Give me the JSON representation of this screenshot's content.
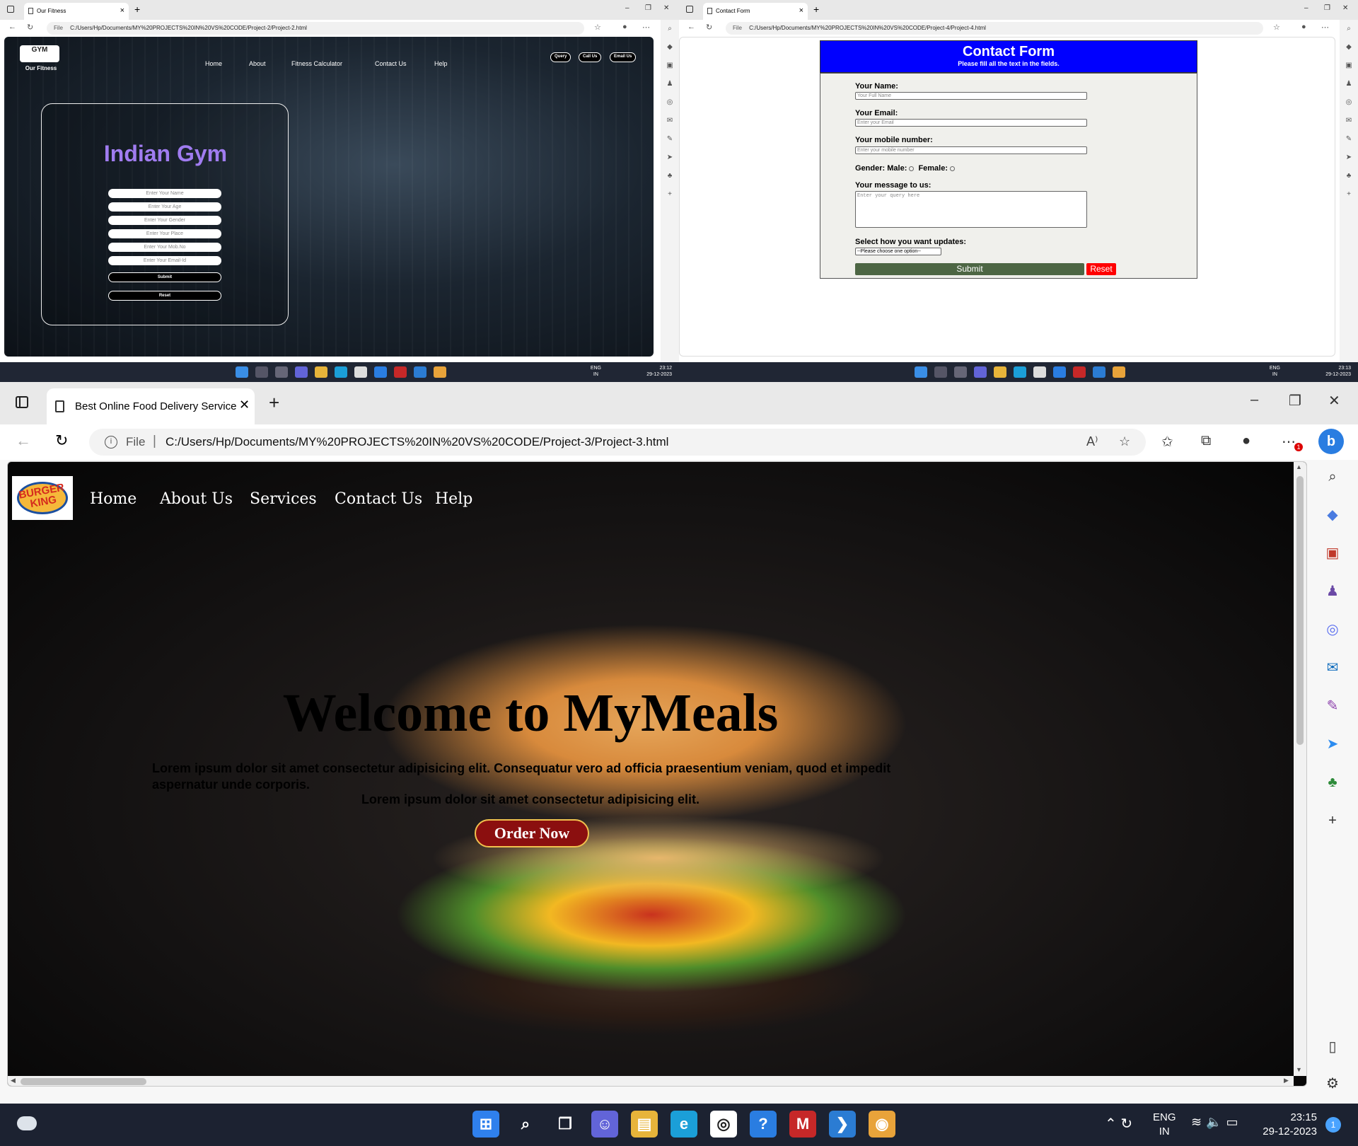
{
  "gym_window": {
    "tab_title": "Our Fitness",
    "url_file": "File",
    "url": "C:/Users/Hp/Documents/MY%20PROJECTS%20IN%20VS%20CODE/Project-2/Project-2.html",
    "logo_badge": "GYM",
    "logo_caption": "Our Fitness",
    "nav": [
      "Home",
      "About",
      "Fitness Calculator",
      "Contact Us",
      "Help"
    ],
    "pills": [
      "Query",
      "Call Us",
      "Email Us"
    ],
    "title": "Indian Gym",
    "placeholders": [
      "Enter Your Name",
      "Enter Your Age",
      "Enter Your Gender",
      "Enter Your Place",
      "Enter Your Mob.No",
      "Enter Your Email-Id"
    ],
    "submit": "Submit",
    "reset": "Reset",
    "taskbar": {
      "lang": "ENG",
      "region": "IN",
      "time": "23:12",
      "date": "29-12-2023"
    }
  },
  "contact_window": {
    "tab_title": "Contact Form",
    "url_file": "File",
    "url": "C:/Users/Hp/Documents/MY%20PROJECTS%20IN%20VS%20CODE/Project-4/Project-4.html",
    "header_title": "Contact Form",
    "header_subtitle": "Please fill all the text in the fields.",
    "name_label": "Your Name:",
    "name_placeholder": "Your Full Name",
    "email_label": "Your Email:",
    "email_placeholder": "Enter your Email",
    "mobile_label": "Your mobile number:",
    "mobile_placeholder": "Enter your mobile number",
    "gender_label": "Gender:",
    "male": "Male:",
    "female": "Female:",
    "message_label": "Your message to us:",
    "message_placeholder": "Enter your query here",
    "updates_label": "Select how you want updates:",
    "select_value": "--Please choose one option--",
    "submit": "Submit",
    "reset": "Reset",
    "taskbar": {
      "lang": "ENG",
      "region": "IN",
      "time": "23:13",
      "date": "29-12-2023"
    }
  },
  "main_window": {
    "tab_title": "Best Online Food Delivery Service",
    "url_file": "File",
    "url": "C:/Users/Hp/Documents/MY%20PROJECTS%20IN%20VS%20CODE/Project-3/Project-3.html",
    "notification_badge": "1",
    "logo_text_top": "BURGER",
    "logo_text_bottom": "KING",
    "nav": [
      "Home",
      "About Us",
      "Services",
      "Contact Us",
      "Help"
    ],
    "hero_title": "Welcome to MyMeals",
    "hero_paragraph": "Lorem ipsum dolor sit amet consectetur adipisicing elit. Consequatur vero ad officia praesentium veniam, quod et impedit aspernatur unde corporis.",
    "hero_paragraph_2": "Lorem ipsum dolor sit amet consectetur adipisicing elit.",
    "order_button": "Order Now"
  },
  "taskbar": {
    "lang": "ENG",
    "region": "IN",
    "time": "23:15",
    "date": "29-12-2023",
    "notifications": "1"
  },
  "colors": {
    "gym_title": "#a07cf0",
    "contact_header": "#0000ff",
    "contact_submit": "#4d6644",
    "contact_reset": "#ff0000",
    "order_button": "#8b0f0f",
    "order_border": "#f2c14e"
  }
}
